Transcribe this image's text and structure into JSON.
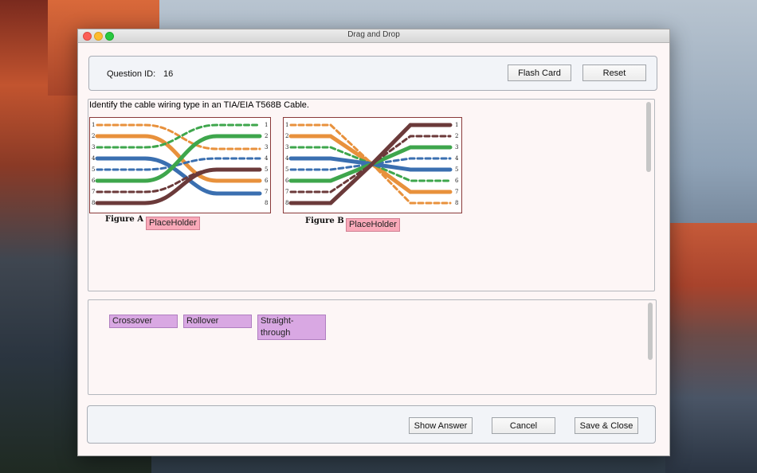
{
  "window": {
    "title": "Drag and Drop"
  },
  "header": {
    "question_id_label": "Question ID:",
    "question_id_value": "16",
    "flash_card_label": "Flash Card",
    "reset_label": "Reset"
  },
  "question": {
    "text": "Identify the cable wiring type in an TIA/EIA T568B Cable.",
    "figure_a_label": "Figure A :",
    "figure_b_label": "Figure B :",
    "figure_a_placeholder": "PlaceHolder",
    "figure_b_placeholder": "PlaceHolder",
    "pin_numbers": [
      "1",
      "2",
      "3",
      "4",
      "5",
      "6",
      "7",
      "8"
    ]
  },
  "answers": {
    "options": [
      "Crossover",
      "Rollover",
      "Straight-through"
    ]
  },
  "footer": {
    "show_answer_label": "Show Answer",
    "cancel_label": "Cancel",
    "save_close_label": "Save & Close"
  },
  "colors": {
    "placeholder_bg": "#f9a9b9",
    "option_bg": "#d9a8e3",
    "wire_orange": "#e8913c",
    "wire_green": "#3ea64c",
    "wire_blue": "#3a6fb0",
    "wire_brown": "#6b3a3a"
  }
}
